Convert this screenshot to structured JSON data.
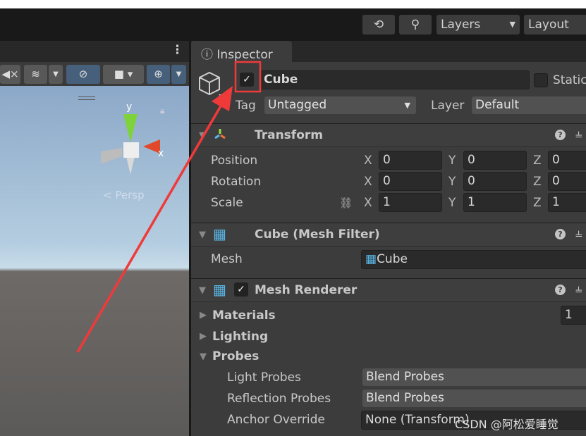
{
  "toolbar": {
    "history_icon": "history-icon",
    "search_icon": "search-icon",
    "layers": "Layers",
    "layout": "Layout"
  },
  "scene": {
    "gizmo_y": "y",
    "gizmo_x": "x",
    "persp": "Persp"
  },
  "inspector": {
    "tab": "Inspector",
    "object_name": "Cube",
    "static": "Static",
    "tag_label": "Tag",
    "tag": "Untagged",
    "layer_label": "Layer",
    "layer": "Default",
    "transform": {
      "title": "Transform",
      "rows": [
        {
          "label": "Position",
          "x": "0",
          "y": "0",
          "z": "0"
        },
        {
          "label": "Rotation",
          "x": "0",
          "y": "0",
          "z": "0"
        },
        {
          "label": "Scale",
          "x": "1",
          "y": "1",
          "z": "1"
        }
      ],
      "axis_x": "X",
      "axis_y": "Y",
      "axis_z": "Z"
    },
    "mesh_filter": {
      "title": "Cube (Mesh Filter)",
      "mesh_label": "Mesh",
      "mesh": "Cube"
    },
    "mesh_renderer": {
      "title": "Mesh Renderer",
      "materials": "Materials",
      "materials_count": "1",
      "lighting": "Lighting",
      "probes": "Probes",
      "light_probes_label": "Light Probes",
      "light_probes": "Blend Probes",
      "reflection_probes_label": "Reflection Probes",
      "reflection_probes": "Blend Probes",
      "anchor_label": "Anchor Override",
      "anchor": "None (Transform)"
    }
  },
  "watermark": "CSDN @阿松爱睡觉",
  "colors": {
    "annotation": "#f03a3a",
    "accent_blue": "#46607c"
  }
}
